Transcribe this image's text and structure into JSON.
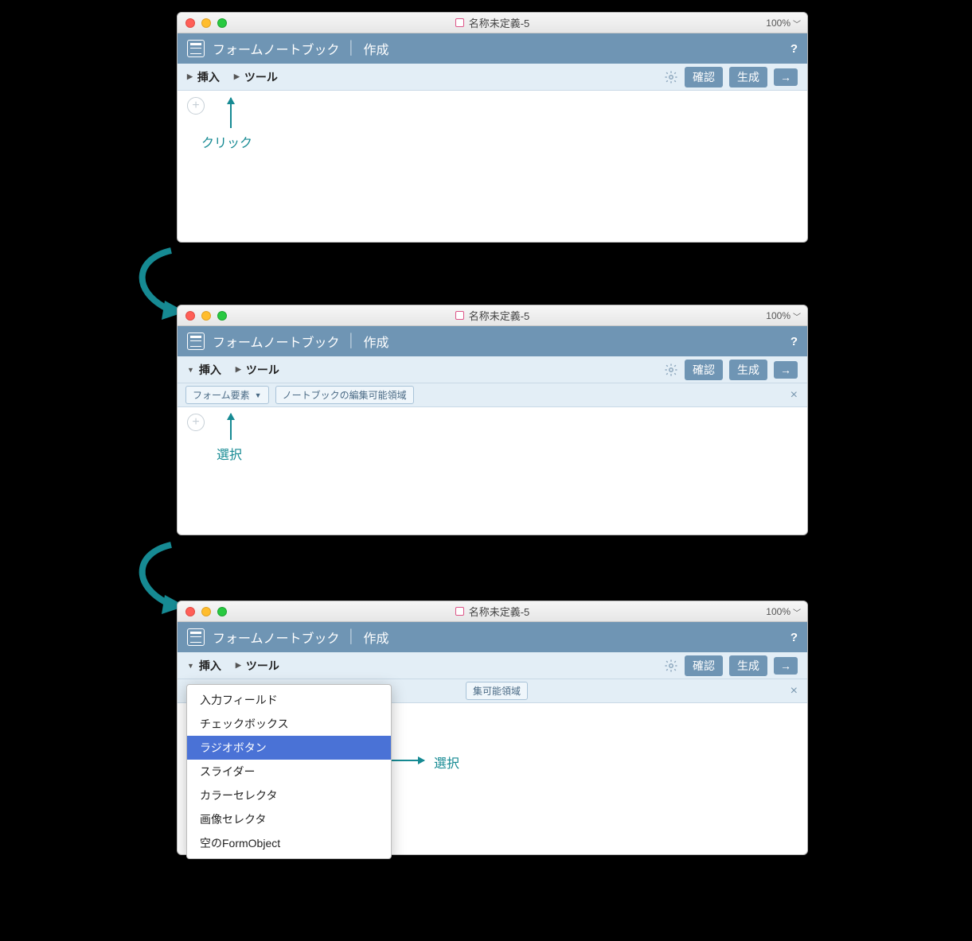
{
  "windows": {
    "title": "名称未定義-5",
    "zoom": "100%"
  },
  "header": {
    "title": "フォームノートブック",
    "mode": "作成",
    "help": "?"
  },
  "toolbar": {
    "insert": "挿入",
    "tools": "ツール",
    "confirm": "確認",
    "generate": "生成",
    "arrow": "→"
  },
  "subbar": {
    "form_elements": "フォーム要素",
    "editable_area": "ノートブックの編集可能領域",
    "editable_area_short": "集可能領域",
    "close": "×"
  },
  "dropdown_options": [
    "入力フィールド",
    "チェックボックス",
    "ラジオボタン",
    "スライダー",
    "カラーセレクタ",
    "画像セレクタ",
    "空のFormObject"
  ],
  "dropdown_selected_index": 2,
  "annotations": {
    "click": "クリック",
    "select1": "選択",
    "select2": "選択"
  }
}
